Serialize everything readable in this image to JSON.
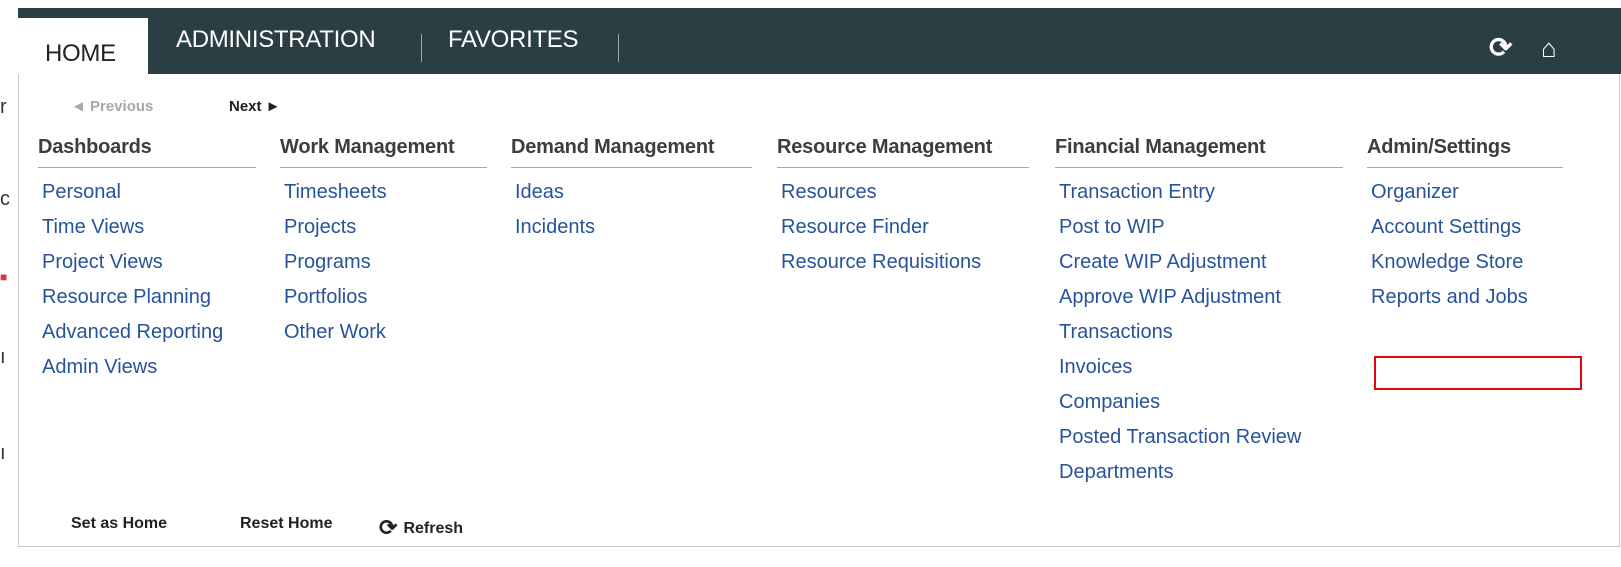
{
  "nav": {
    "tabs": [
      {
        "label": "HOME",
        "active": true
      },
      {
        "label": "ADMINISTRATION",
        "active": false
      },
      {
        "label": "FAVORITES",
        "active": false
      }
    ],
    "icons": [
      "refresh-icon",
      "home-icon"
    ]
  },
  "pager": {
    "previous_label": "◄ Previous",
    "next_label": "Next ►"
  },
  "menu": {
    "columns": [
      {
        "header": "Dashboards",
        "items": [
          "Personal",
          "Time Views",
          "Project Views",
          "Resource Planning",
          "Advanced Reporting",
          "Admin Views"
        ]
      },
      {
        "header": "Work Management",
        "items": [
          "Timesheets",
          "Projects",
          "Programs",
          "Portfolios",
          "Other Work"
        ]
      },
      {
        "header": "Demand Management",
        "items": [
          "Ideas",
          "Incidents"
        ]
      },
      {
        "header": "Resource Management",
        "items": [
          "Resources",
          "Resource Finder",
          "Resource Requisitions"
        ]
      },
      {
        "header": "Financial Management",
        "items": [
          "Transaction Entry",
          "Post to WIP",
          "Create WIP Adjustment",
          "Approve WIP Adjustment",
          "Transactions",
          "Invoices",
          "Companies",
          "Posted Transaction Review",
          "Departments"
        ]
      },
      {
        "header": "Admin/Settings",
        "items": [
          "Organizer",
          "Account Settings",
          "Knowledge Store",
          "Reports and Jobs"
        ]
      }
    ],
    "highlighted_item": "Reports and Jobs"
  },
  "footer": {
    "set_home_label": "Set as Home",
    "reset_home_label": "Reset Home",
    "refresh_label": "Refresh"
  },
  "colors": {
    "navbar_bg": "#2b3e43",
    "link": "#27539a",
    "highlight": "#e30613"
  }
}
